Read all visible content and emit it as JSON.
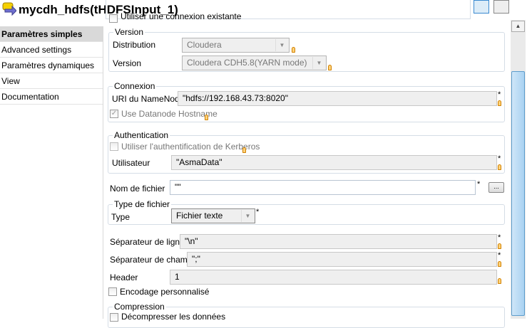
{
  "header": {
    "title": "mycdh_hdfs(tHDFSInput_1)"
  },
  "nav": {
    "items": [
      "Paramètres simples",
      "Advanced settings",
      "Paramètres dynamiques",
      "View",
      "Documentation"
    ]
  },
  "form": {
    "existing_connection": "Utiliser une connexion existante",
    "version_group": "Version",
    "distribution_label": "Distribution",
    "distribution_value": "Cloudera",
    "version_label": "Version",
    "version_value": "Cloudera CDH5.8(YARN mode)",
    "connexion_group": "Connexion",
    "uri_label": "URI du NameNode",
    "uri_value": "\"hdfs://192.168.43.73:8020\"",
    "datanode_label": "Use Datanode Hostname",
    "auth_group": "Authentication",
    "kerberos_label": "Utiliser l'authentification de Kerberos",
    "user_label": "Utilisateur",
    "user_value": "\"AsmaData\"",
    "filename_label": "Nom de fichier",
    "filename_value": "\"\"",
    "browse_label": "...",
    "filetype_group": "Type de fichier",
    "type_label": "Type",
    "type_value": "Fichier texte",
    "row_sep_label": "Séparateur de lignes",
    "row_sep_value": "\"\\n\"",
    "field_sep_label": "Séparateur de champs",
    "field_sep_value": "\";\"",
    "header_label": "Header",
    "header_value": "1",
    "encoding_label": "Encodage personnalisé",
    "compression_group": "Compression",
    "decompress_label": "Décompresser les données",
    "required_mark": "*"
  }
}
